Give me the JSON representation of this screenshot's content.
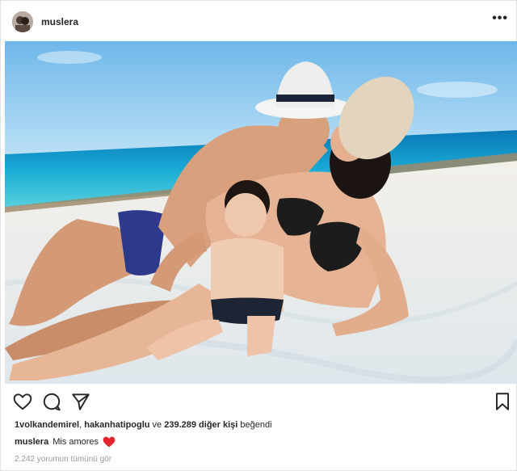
{
  "post": {
    "username": "muslera",
    "more_icon": "more-horizontal-icon",
    "more_label": "•••"
  },
  "actions": {
    "like_icon": "heart-outline-icon",
    "comment_icon": "comment-icon",
    "share_icon": "send-icon",
    "save_icon": "bookmark-icon"
  },
  "likes": {
    "user1": "1volkandemirel",
    "sep": ", ",
    "user2": "hakanhatipoglu",
    "conj": " ve ",
    "count": "239.289 diğer kişi",
    "suffix": " beğendi"
  },
  "caption": {
    "username": "muslera",
    "text": "Mis amores",
    "emoji": "red-heart",
    "heart_color": "#e0262c"
  },
  "comments": {
    "view_all": "2.242 yorumun tümünü gör"
  },
  "colors": {
    "sky": "#7ec3ec",
    "sea": "#1aa2cf",
    "sand": "#eef1f2"
  }
}
